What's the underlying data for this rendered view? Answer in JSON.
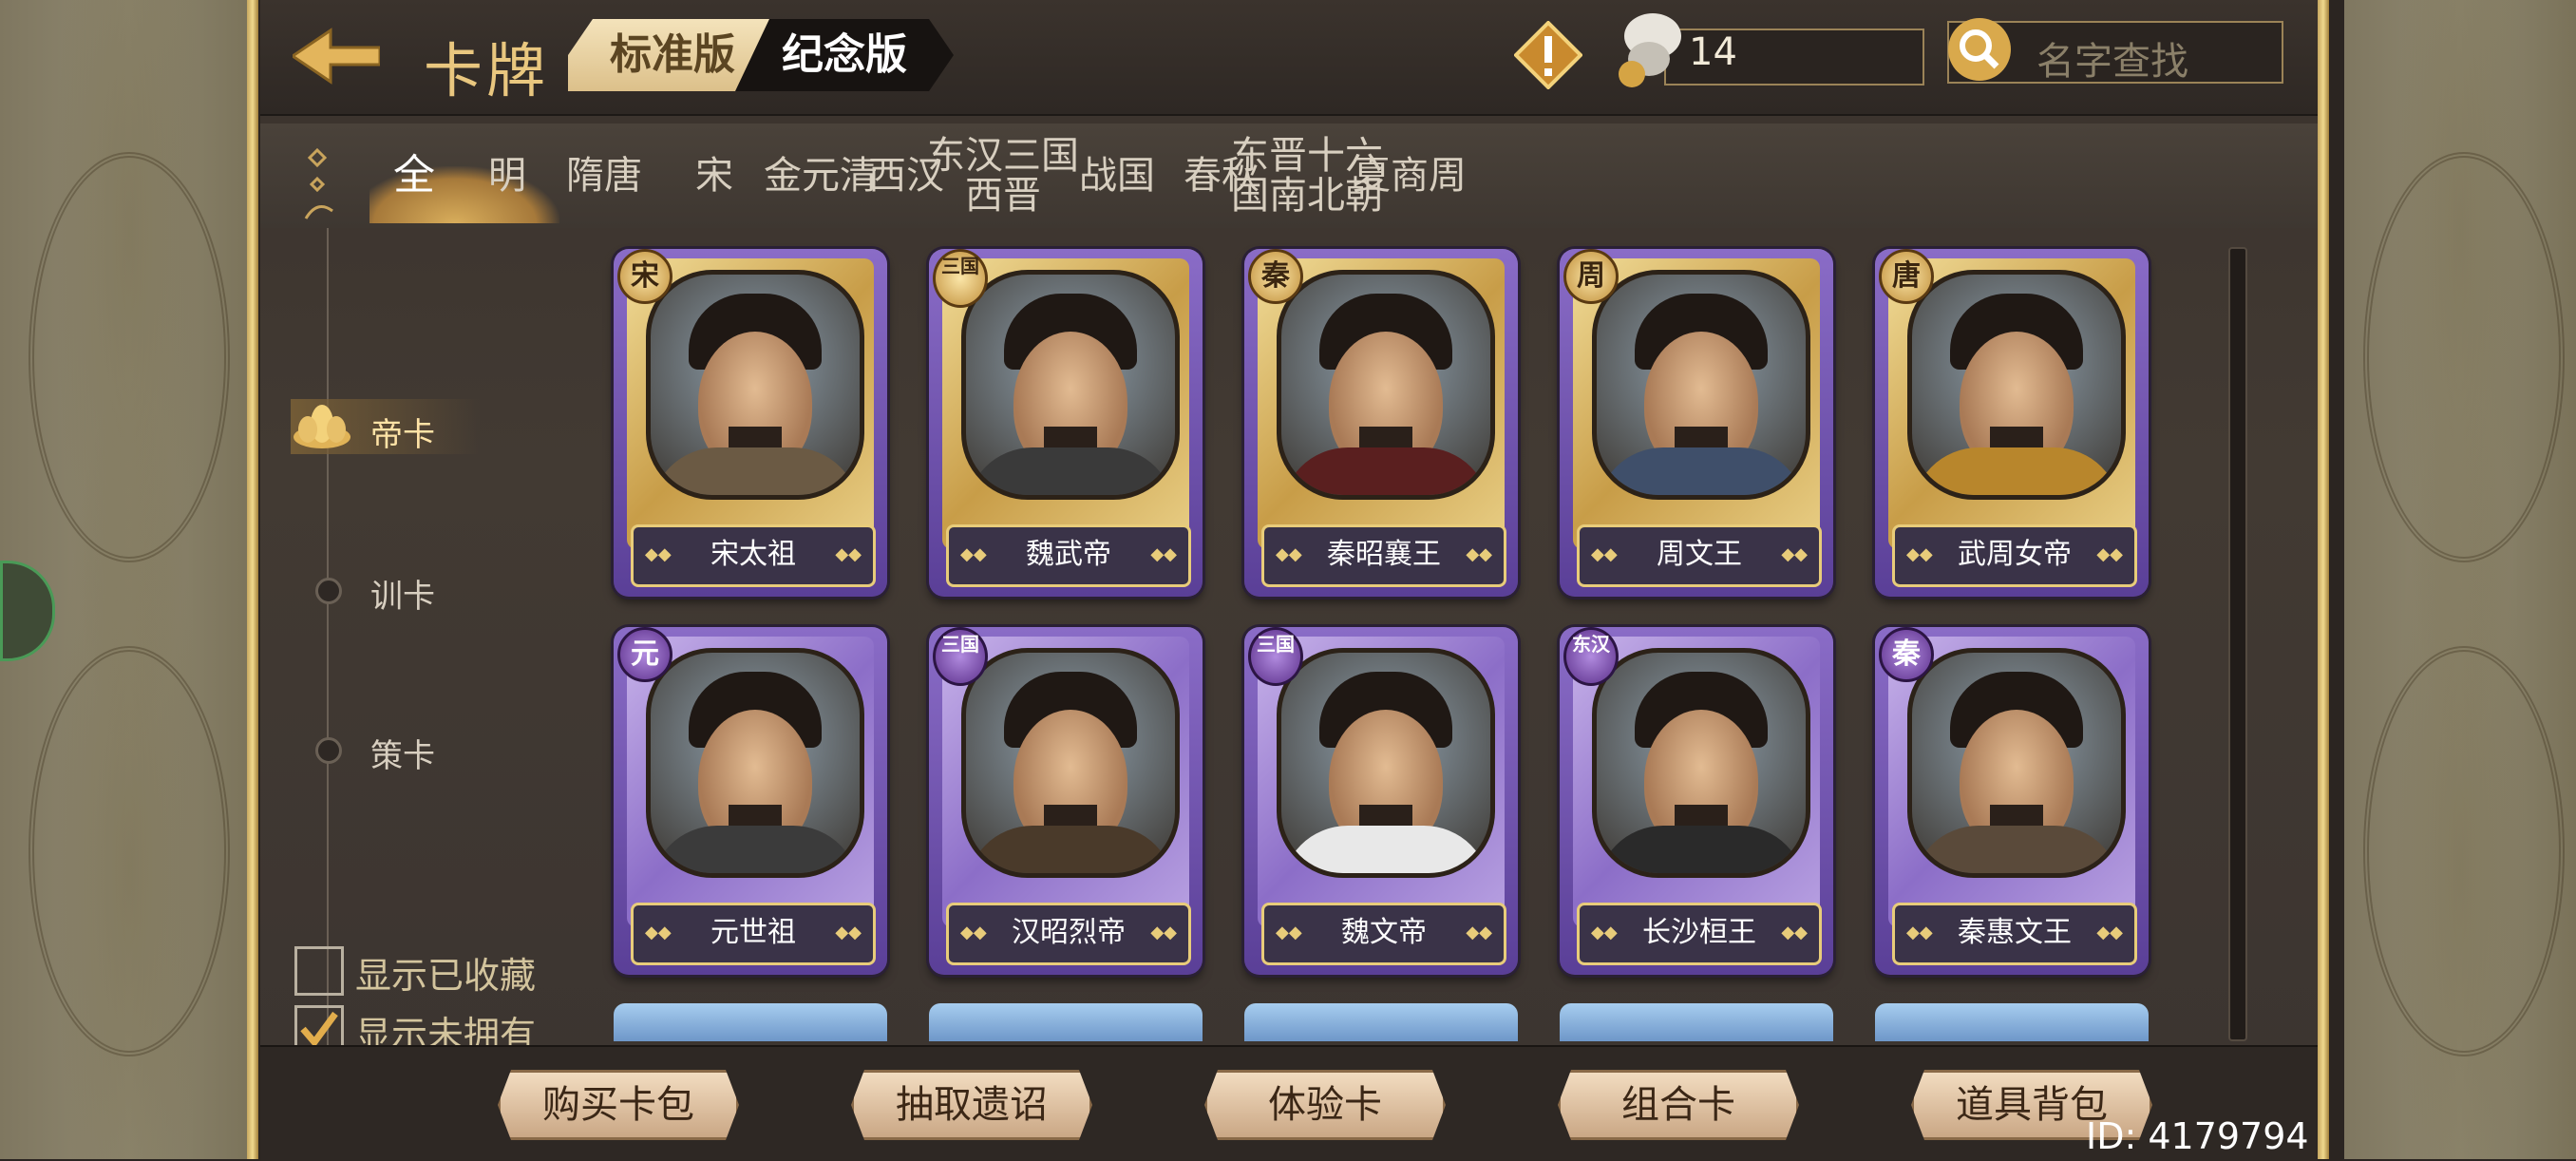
{
  "header": {
    "title": "卡牌",
    "edition_tabs": [
      "标准版",
      "纪念版"
    ],
    "currency_value": "14",
    "search_placeholder": "名字查找"
  },
  "era_tabs": [
    "全",
    "明",
    "隋唐",
    "宋",
    "金元清",
    "西汉",
    "东汉三国\n西晋",
    "战国",
    "春秋",
    "东晋十六\n国南北朝",
    "夏商周"
  ],
  "sidebar": {
    "categories": [
      "帝卡",
      "训卡",
      "策卡"
    ],
    "active_category": "帝卡",
    "filters": [
      {
        "label": "显示已收藏",
        "checked": false
      },
      {
        "label": "显示未拥有",
        "checked": true
      }
    ]
  },
  "cards": [
    {
      "name": "宋太祖",
      "era": "宋",
      "frame": "gold"
    },
    {
      "name": "魏武帝",
      "era": "三国",
      "frame": "gold"
    },
    {
      "name": "秦昭襄王",
      "era": "秦",
      "frame": "gold"
    },
    {
      "name": "周文王",
      "era": "周",
      "frame": "gold"
    },
    {
      "name": "武周女帝",
      "era": "唐",
      "frame": "gold"
    },
    {
      "name": "元世祖",
      "era": "元",
      "frame": "purple"
    },
    {
      "name": "汉昭烈帝",
      "era": "三国",
      "frame": "purple"
    },
    {
      "name": "魏文帝",
      "era": "三国",
      "frame": "purple"
    },
    {
      "name": "长沙桓王",
      "era": "东汉",
      "frame": "purple"
    },
    {
      "name": "秦惠文王",
      "era": "秦",
      "frame": "purple"
    }
  ],
  "bottom_buttons": [
    "购买卡包",
    "抽取遗诏",
    "体验卡",
    "组合卡",
    "道具背包"
  ],
  "player_id": "ID: 4179794",
  "colors": {
    "accent_gold": "#e9c77f",
    "card_purple": "#7a5cb8",
    "bg_dark": "#3a322c"
  }
}
